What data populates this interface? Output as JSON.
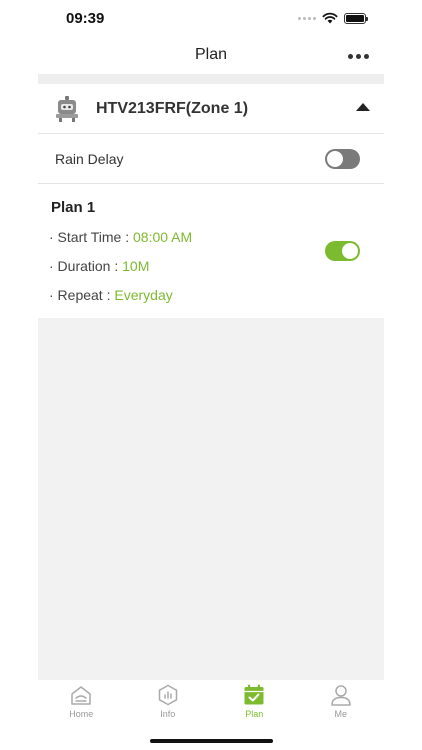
{
  "status_bar": {
    "time": "09:39"
  },
  "nav": {
    "title": "Plan"
  },
  "device": {
    "name": "HTV213FRF(Zone 1)"
  },
  "rain_delay": {
    "label": "Rain Delay",
    "enabled": false
  },
  "plan": {
    "title": "Plan 1",
    "start_time_label": "· Start Time : ",
    "start_time_value": "08:00 AM",
    "duration_label": "· Duration : ",
    "duration_value": "10M",
    "repeat_label": "· Repeat : ",
    "repeat_value": "Everyday",
    "enabled": true
  },
  "tabs": [
    {
      "label": "Home",
      "icon": "home-icon",
      "active": false
    },
    {
      "label": "Info",
      "icon": "info-icon",
      "active": false
    },
    {
      "label": "Plan",
      "icon": "calendar-check-icon",
      "active": true
    },
    {
      "label": "Me",
      "icon": "person-icon",
      "active": false
    }
  ],
  "colors": {
    "accent": "#7cbb2f",
    "toggle_off": "#7a7a7a",
    "background_empty": "#f2f2f2"
  }
}
